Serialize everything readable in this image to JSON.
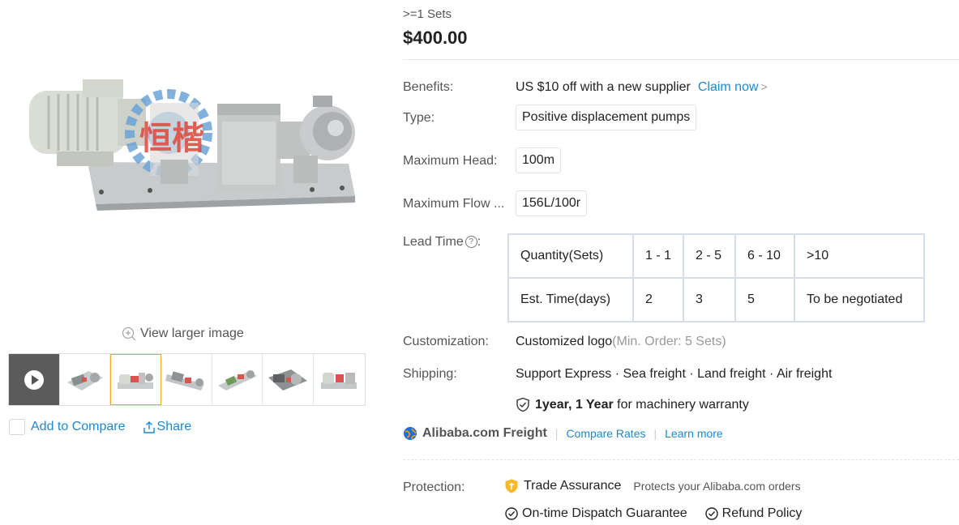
{
  "gallery": {
    "view_larger": "View larger image",
    "add_to_compare": "Add to Compare",
    "share": "Share",
    "logo_watermark": "恒楷"
  },
  "price_tier": {
    "quantity": ">=1 Sets",
    "price": "$400.00"
  },
  "attributes": {
    "benefits_label": "Benefits:",
    "benefits_value": "US $10 off with a new supplier",
    "claim_now": "Claim now",
    "type_label": "Type:",
    "type_value": "Positive displacement pumps",
    "max_head_label": "Maximum Head:",
    "max_head_value": "100m",
    "max_flow_label": "Maximum Flow ...",
    "max_flow_value": "156L/100r"
  },
  "lead_time": {
    "label": "Lead Time",
    "rows": [
      [
        "Quantity(Sets)",
        "1 - 1",
        "2 - 5",
        "6 - 10",
        ">10"
      ],
      [
        "Est. Time(days)",
        "2",
        "3",
        "5",
        "To be negotiated"
      ]
    ]
  },
  "customization": {
    "label": "Customization:",
    "value": "Customized logo",
    "note": "(Min. Order: 5 Sets)"
  },
  "shipping": {
    "label": "Shipping:",
    "value": "Support Express · Sea freight · Land freight · Air freight",
    "warranty_bold": "1year, 1 Year",
    "warranty_rest": "for machinery warranty"
  },
  "freight": {
    "brand": "Alibaba.com Freight",
    "compare_rates": "Compare Rates",
    "learn_more": "Learn more"
  },
  "protection": {
    "label": "Protection:",
    "trade_assurance": "Trade Assurance",
    "trade_assurance_desc": "Protects your Alibaba.com orders",
    "dispatch": "On-time Dispatch Guarantee",
    "refund": "Refund Policy"
  },
  "colors": {
    "link": "#1e88d0",
    "active_thumb_border": "#f5a623",
    "trade_assurance_icon": "#f5b82e"
  }
}
